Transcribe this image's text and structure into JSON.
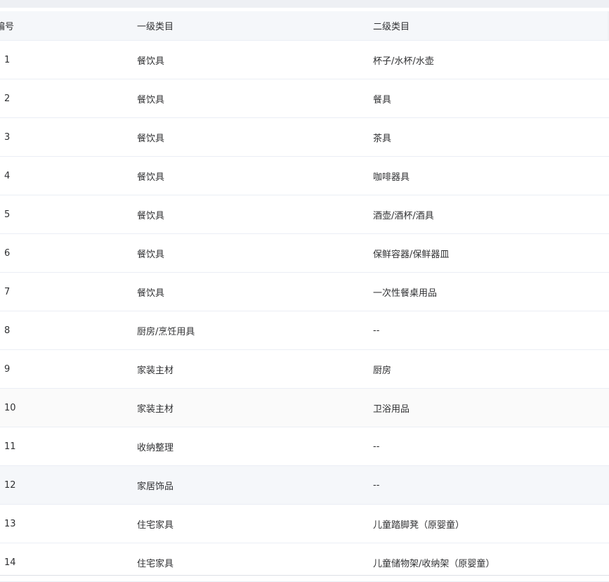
{
  "table": {
    "headers": {
      "id": "编号",
      "category1": "一级类目",
      "category2": "二级类目"
    },
    "rows": [
      {
        "id": "1",
        "category1": "餐饮具",
        "category2": "杯子/水杯/水壶"
      },
      {
        "id": "2",
        "category1": "餐饮具",
        "category2": "餐具"
      },
      {
        "id": "3",
        "category1": "餐饮具",
        "category2": "茶具"
      },
      {
        "id": "4",
        "category1": "餐饮具",
        "category2": "咖啡器具"
      },
      {
        "id": "5",
        "category1": "餐饮具",
        "category2": "酒壶/酒杯/酒具"
      },
      {
        "id": "6",
        "category1": "餐饮具",
        "category2": "保鲜容器/保鲜器皿"
      },
      {
        "id": "7",
        "category1": "餐饮具",
        "category2": "一次性餐桌用品"
      },
      {
        "id": "8",
        "category1": "厨房/烹饪用具",
        "category2": "--"
      },
      {
        "id": "9",
        "category1": "家装主材",
        "category2": "厨房"
      },
      {
        "id": "10",
        "category1": "家装主材",
        "category2": "卫浴用品"
      },
      {
        "id": "11",
        "category1": "收纳整理",
        "category2": "--"
      },
      {
        "id": "12",
        "category1": "家居饰品",
        "category2": "--"
      },
      {
        "id": "13",
        "category1": "住宅家具",
        "category2": "儿童踏脚凳（原婴童）"
      },
      {
        "id": "14",
        "category1": "住宅家具",
        "category2": "儿童储物架/收纳架（原婴童）"
      }
    ]
  }
}
